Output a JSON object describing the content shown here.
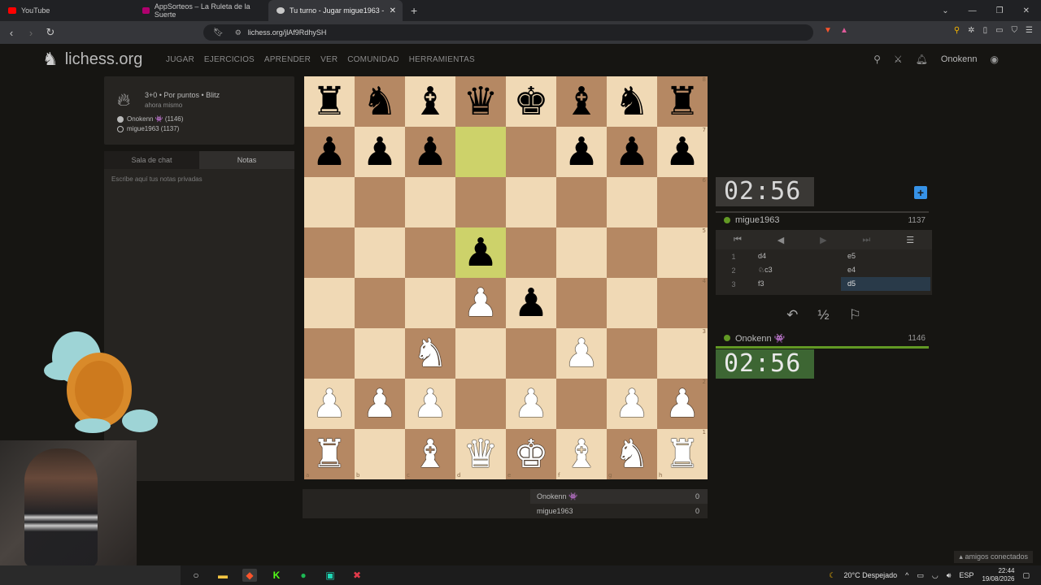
{
  "browser": {
    "tabs": [
      {
        "title": "YouTube",
        "color": "#ff0000",
        "active": false
      },
      {
        "title": "AppSorteos – La Ruleta de la Suerte",
        "color": "#b0006e",
        "active": false
      },
      {
        "title": "Tu turno - Jugar migue1963 -",
        "color": "#c8c8c8",
        "active": true
      }
    ],
    "url": "lichess.org/jlAf9RdhySH"
  },
  "site": {
    "logo": "lichess.org",
    "nav": [
      "JUGAR",
      "EJERCICIOS",
      "APRENDER",
      "VER",
      "COMUNIDAD",
      "HERRAMIENTAS"
    ],
    "username": "Onokenn"
  },
  "game": {
    "title": "3+0 • Por puntos • Blitz",
    "time": "ahora mismo",
    "white": "Onokenn 👾 (1146)",
    "black": "migue1963 (1137)"
  },
  "chat": {
    "tab_chat": "Sala de chat",
    "tab_notes": "Notas",
    "notes_placeholder": "Escribe aquí tus notas privadas"
  },
  "board": {
    "ranks": [
      "8",
      "7",
      "6",
      "5",
      "4",
      "3",
      "2",
      "1"
    ],
    "files": [
      "a",
      "b",
      "c",
      "d",
      "e",
      "f",
      "g",
      "h"
    ],
    "position": [
      [
        "r",
        "n",
        "b",
        "q",
        "k",
        "b",
        "n",
        "r"
      ],
      [
        "p",
        "p",
        "p",
        "",
        "",
        "p",
        "p",
        "p"
      ],
      [
        "",
        "",
        "",
        "",
        "",
        "",
        "",
        ""
      ],
      [
        "",
        "",
        "",
        "p",
        "",
        "",
        "",
        ""
      ],
      [
        "",
        "",
        "",
        "P",
        "p",
        "",
        "",
        ""
      ],
      [
        "",
        "",
        "N",
        "",
        "",
        "P",
        "",
        ""
      ],
      [
        "P",
        "P",
        "P",
        "",
        "P",
        "",
        "P",
        "P"
      ],
      [
        "R",
        "",
        "B",
        "Q",
        "K",
        "B",
        "N",
        "R"
      ]
    ],
    "last_move": [
      "d7",
      "d5"
    ]
  },
  "clocks": {
    "top": "02:56",
    "bottom": "02:56"
  },
  "players": {
    "top_name": "migue1963",
    "top_rating": "1137",
    "bottom_name": "Onokenn 👾",
    "bottom_rating": "1146"
  },
  "moves": [
    {
      "num": "1",
      "white": "d4",
      "black": "e5"
    },
    {
      "num": "2",
      "white": "♘c3",
      "black": "e4"
    },
    {
      "num": "3",
      "white": "f3",
      "black": "d5"
    }
  ],
  "material": {
    "top_name": "Onokenn 👾",
    "top_score": "0",
    "bottom_name": "migue1963",
    "bottom_score": "0"
  },
  "taskbar": {
    "weather": "20°C Despejado",
    "lang": "ESP",
    "time": "22:44",
    "date": "19/08/2026",
    "friends": "amigos conectados"
  }
}
